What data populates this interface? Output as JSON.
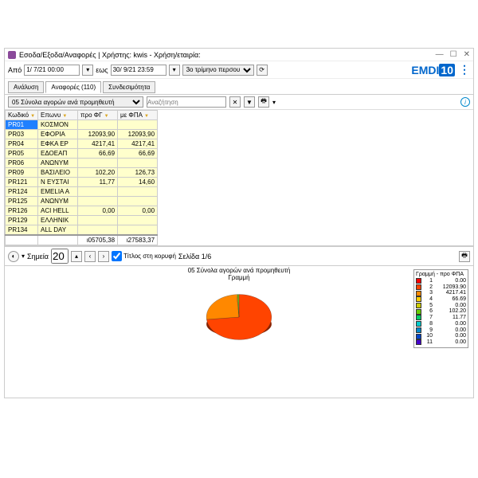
{
  "window_title": "Εσοδα/Εξοδα/Αναφορές  | Χρήστης: kwis - Χρήση/εταιρία:",
  "date_from_label": "Από",
  "date_from": "1/ 7/21 00:00",
  "date_to_label": "εως",
  "date_to": "30/ 9/21 23:59",
  "period": "3ο τρίμηνο περσου",
  "brand_left": "EMDI",
  "brand_box": "10",
  "tabs": {
    "t0": "Ανάλυση",
    "t1": "Αναφορές (110)",
    "t2": "Συνδεσιμότητα"
  },
  "dropdown_report": "05 Σύνολα αγορών ανά προμηθευτή",
  "search_ph": "Αναζήτηση",
  "columns": {
    "c0": "Κωδικό",
    "c1": "Επωνυ",
    "c2": "προ ΦΓ",
    "c3": "με ΦΠΑ"
  },
  "rows": [
    {
      "c0": "PR01",
      "c1": "ΚΟΣΜΟΝ",
      "c2": "",
      "c3": ""
    },
    {
      "c0": "PR03",
      "c1": "ΕΦΟΡΙΑ",
      "c2": "12093,90",
      "c3": "12093,90"
    },
    {
      "c0": "PR04",
      "c1": "ΕΦΚΑ ΕΡ",
      "c2": "4217,41",
      "c3": "4217,41"
    },
    {
      "c0": "PR05",
      "c1": "ΕΔΟΕΑΠ",
      "c2": "66,69",
      "c3": "66,69"
    },
    {
      "c0": "PR06",
      "c1": "ΑΝΩΝΥΜ",
      "c2": "",
      "c3": ""
    },
    {
      "c0": "PR09",
      "c1": "ΒΑΣΙΛΕΙΟ",
      "c2": "102,20",
      "c3": "126,73"
    },
    {
      "c0": "PR121",
      "c1": "Ν ΕΥΣΤΑΙ",
      "c2": "11,77",
      "c3": "14,60"
    },
    {
      "c0": "PR124",
      "c1": "EMELIA A",
      "c2": "",
      "c3": ""
    },
    {
      "c0": "PR125",
      "c1": "ΑΝΩΝΥΜ",
      "c2": "",
      "c3": ""
    },
    {
      "c0": "PR126",
      "c1": "ACI HELL",
      "c2": "0,00",
      "c3": "0,00"
    },
    {
      "c0": "PR129",
      "c1": "ΕΛΛΗΝΙΚ",
      "c2": "",
      "c3": ""
    },
    {
      "c0": "PR134",
      "c1": "ALL DAY",
      "c2": "",
      "c3": ""
    }
  ],
  "totals": {
    "c2": "ι05705,38",
    "c3": "ι27583,37"
  },
  "points_label": "Σημεία",
  "points_value": "20",
  "title_on_top": "Τίτλος στη κορυφή",
  "page_label": "Σελίδα 1/6",
  "chart_title_1": "05 Σύνολα αγορών ανά προμηθευτή",
  "chart_title_2": "Γραμμή",
  "legend_title": "Γραμμή - προ ΦΠΑ",
  "chart_data": {
    "type": "pie",
    "title": "05 Σύνολα αγορών ανά προμηθευτή",
    "series": [
      {
        "name": "1",
        "value": 0.0,
        "color": "#ff0000"
      },
      {
        "name": "2",
        "value": 12093.9,
        "color": "#ff4400"
      },
      {
        "name": "3",
        "value": 4217.41,
        "color": "#ff8800"
      },
      {
        "name": "4",
        "value": 66.69,
        "color": "#ffcc00"
      },
      {
        "name": "5",
        "value": 0.0,
        "color": "#cccc00"
      },
      {
        "name": "6",
        "value": 102.2,
        "color": "#66cc00"
      },
      {
        "name": "7",
        "value": 11.77,
        "color": "#00cc66"
      },
      {
        "name": "8",
        "value": 0.0,
        "color": "#00cccc"
      },
      {
        "name": "9",
        "value": 0.0,
        "color": "#0088cc"
      },
      {
        "name": "10",
        "value": 0.0,
        "color": "#0044cc"
      },
      {
        "name": "11",
        "value": 0.0,
        "color": "#4400cc"
      }
    ]
  }
}
